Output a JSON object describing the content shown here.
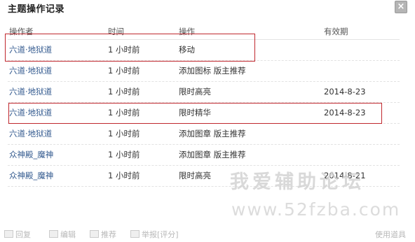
{
  "dialog": {
    "title": "主题操作记录",
    "close_label": "×"
  },
  "table": {
    "headers": {
      "operator": "操作者",
      "time": "时间",
      "action": "操作",
      "validity": "有效期"
    },
    "rows": [
      {
        "operator": "六道·地狱道",
        "time": "1 小时前",
        "action": "移动",
        "validity": ""
      },
      {
        "operator": "六道·地狱道",
        "time": "1 小时前",
        "action": "添加图标 版主推荐",
        "validity": ""
      },
      {
        "operator": "六道·地狱道",
        "time": "1 小时前",
        "action": "限时高亮",
        "validity": "2014-8-23"
      },
      {
        "operator": "六道·地狱道",
        "time": "1 小时前",
        "action": "限时精华",
        "validity": "2014-8-23"
      },
      {
        "operator": "六道·地狱道",
        "time": "1 小时前",
        "action": "添加图章 版主推荐",
        "validity": ""
      },
      {
        "operator": "众神殿_魔神",
        "time": "1 小时前",
        "action": "添加图章 版主推荐",
        "validity": ""
      },
      {
        "operator": "众神殿_魔神",
        "time": "1 小时前",
        "action": "限时高亮",
        "validity": "2014-8-21"
      }
    ]
  },
  "watermark": {
    "site_name": "我爱辅助论坛",
    "url": "www.52fzba.com"
  },
  "footer": {
    "reply": "回复",
    "edit": "编辑",
    "recommend": "推荐",
    "report": "举报[评分]",
    "use_item": "使用道具"
  },
  "colors": {
    "highlight_box": "#c0272d",
    "link": "#335a8f",
    "close_button": "#b5b5b5"
  }
}
